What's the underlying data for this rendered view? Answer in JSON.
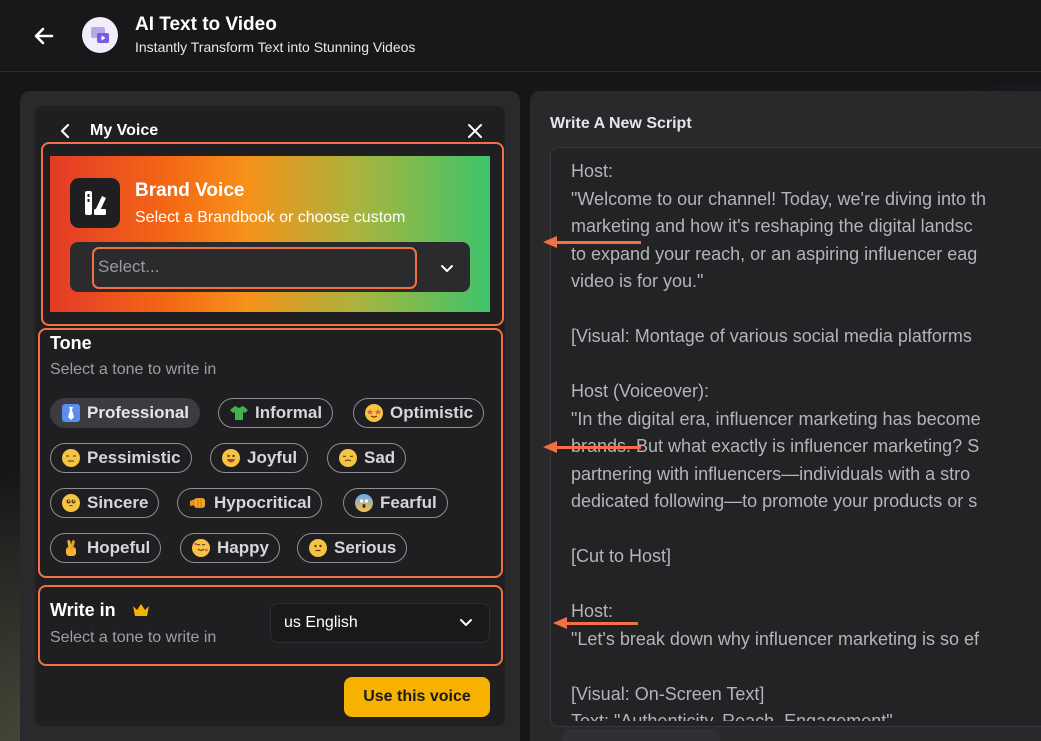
{
  "header": {
    "title": "AI Text to Video",
    "subtitle": "Instantly Transform Text into Stunning Videos",
    "logo_icon": "video-ai-logo-icon"
  },
  "my_voice": {
    "title": "My Voice",
    "brand_voice": {
      "title": "Brand Voice",
      "subtitle": "Select a Brandbook or choose custom",
      "select_placeholder": "Select..."
    },
    "tone": {
      "title": "Tone",
      "subtitle": "Select a tone to write in",
      "selected": "Professional",
      "options": [
        {
          "label": "Professional",
          "emoji_color": "#5b8cf0"
        },
        {
          "label": "Informal",
          "emoji_color": "#3fb34f"
        },
        {
          "label": "Optimistic",
          "emoji_color": "#e94f6b"
        },
        {
          "label": "Pessimistic",
          "emoji_color": "#f5c443"
        },
        {
          "label": "Joyful",
          "emoji_color": "#f5c443"
        },
        {
          "label": "Sad",
          "emoji_color": "#f5c443"
        },
        {
          "label": "Sincere",
          "emoji_color": "#f5c443"
        },
        {
          "label": "Hypocritical",
          "emoji_color": "#f5a623"
        },
        {
          "label": "Fearful",
          "emoji_color": "#6aa6f5"
        },
        {
          "label": "Hopeful",
          "emoji_color": "#f5b233"
        },
        {
          "label": "Happy",
          "emoji_color": "#f57a9b"
        },
        {
          "label": "Serious",
          "emoji_color": "#f5c443"
        }
      ]
    },
    "language": {
      "title": "Write in",
      "subtitle": "Select a tone to write in",
      "selected": "us English"
    },
    "use_button": "Use this voice"
  },
  "script": {
    "label": "Write A New Script",
    "lines": [
      "Host:",
      "\"Welcome to our channel! Today, we're diving into th",
      "marketing and how it's reshaping the digital landsc",
      "to expand your reach, or an aspiring influencer eag",
      "video is for you.\"",
      "",
      "[Visual: Montage of various social media platforms",
      "",
      "Host (Voiceover):",
      "\"In the digital era, influencer marketing has become",
      "brands. But what exactly is influencer marketing? S",
      "partnering with influencers—individuals with a stro",
      "dedicated following—to promote your products or s",
      "",
      "[Cut to Host]",
      "",
      "Host:",
      "\"Let's break down why influencer marketing is so ef",
      "",
      "[Visual: On-Screen Text]",
      "Text: \"Authenticity, Reach, Engagement\""
    ]
  },
  "colors": {
    "accent": "#f7b100",
    "annotation": "#f07242",
    "background": "#141416"
  }
}
